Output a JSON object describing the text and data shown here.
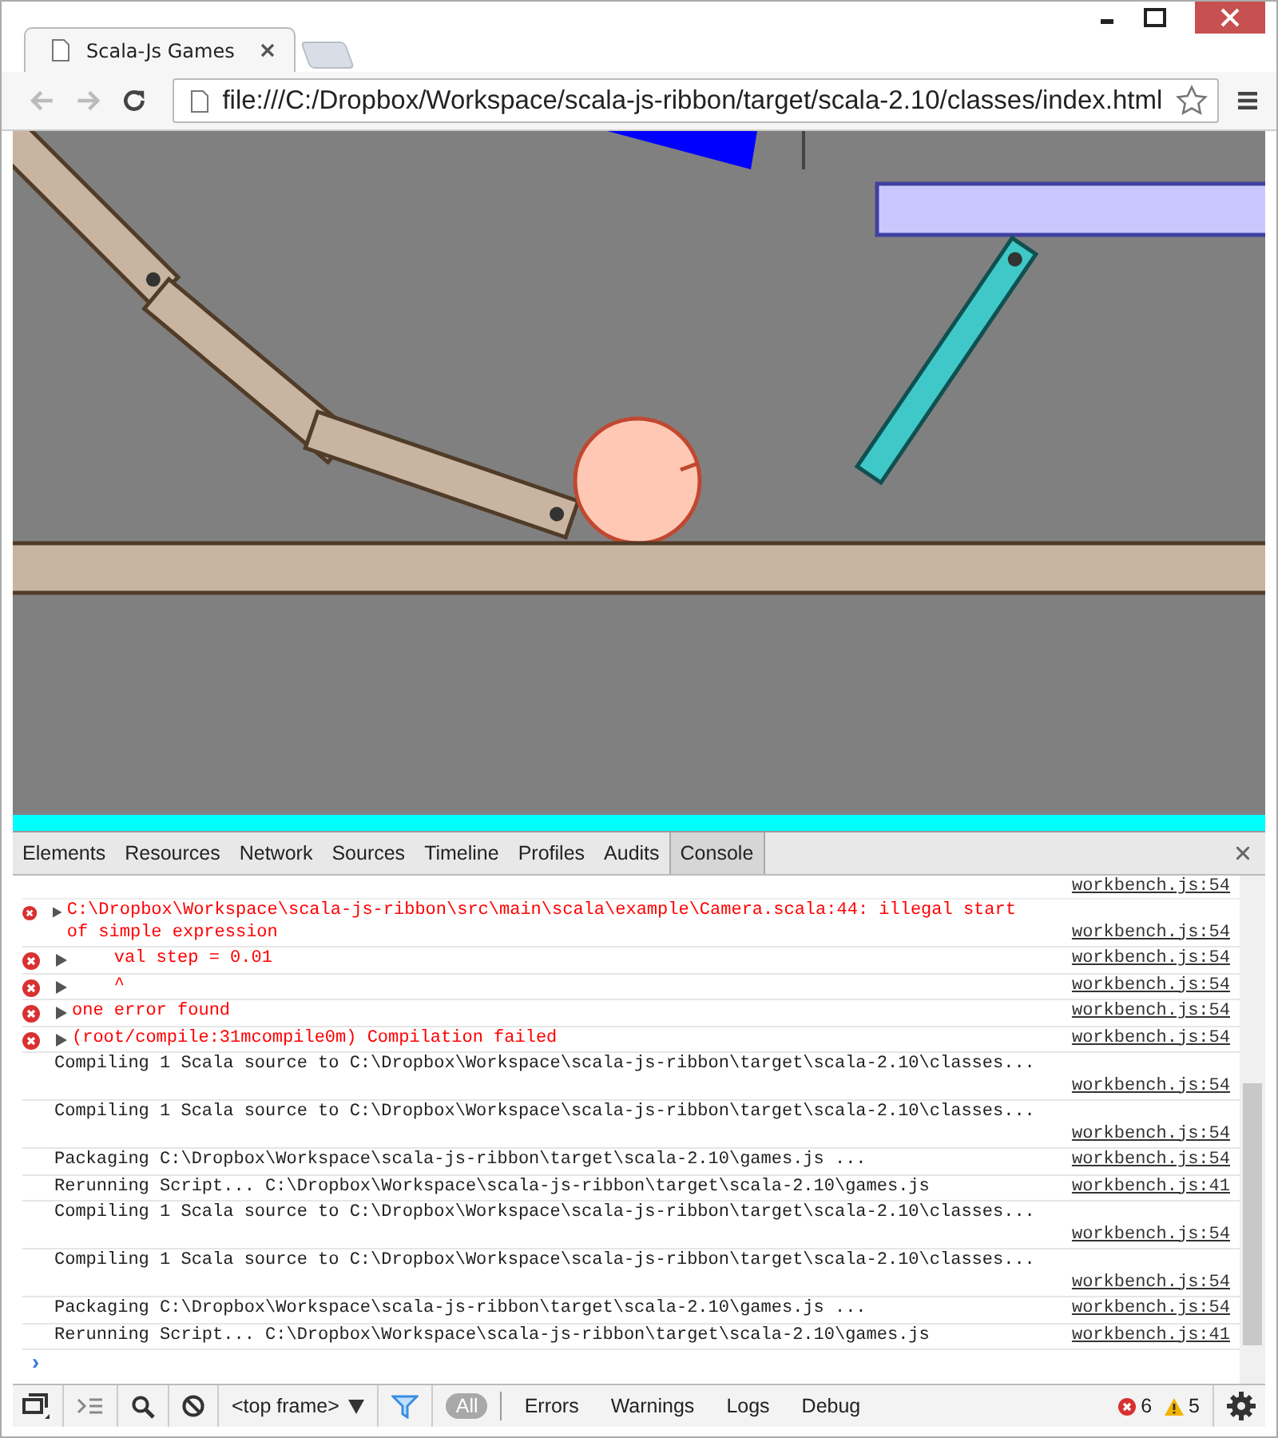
{
  "window": {
    "tabs": [
      {
        "title": "Scala-Js Games",
        "selected": true
      }
    ]
  },
  "toolbar": {
    "url": "file:///C:/Dropbox/Workspace/scala-js-ribbon/target/scala-2.10/classes/index.html"
  },
  "devtools": {
    "tabs": [
      {
        "label": "Elements",
        "selected": false
      },
      {
        "label": "Resources",
        "selected": false
      },
      {
        "label": "Network",
        "selected": false
      },
      {
        "label": "Sources",
        "selected": false
      },
      {
        "label": "Timeline",
        "selected": false
      },
      {
        "label": "Profiles",
        "selected": false
      },
      {
        "label": "Audits",
        "selected": false
      },
      {
        "label": "Console",
        "selected": true
      }
    ],
    "console": {
      "clipped_source": "workbench.js:54",
      "messages": [
        {
          "kind": "error",
          "text": "C:\\Dropbox\\Workspace\\scala-js-ribbon\\src\\main\\scala\\example\\Camera.scala:44: illegal start of simple expression",
          "source": "workbench.js:54"
        },
        {
          "kind": "error",
          "text": "    val step = 0.01",
          "source": "workbench.js:54"
        },
        {
          "kind": "error",
          "text": "    ^",
          "source": "workbench.js:54"
        },
        {
          "kind": "error",
          "text": "one error found",
          "source": "workbench.js:54"
        },
        {
          "kind": "error",
          "text": "(root/compile:31mcompile0m) Compilation failed",
          "source": "workbench.js:54"
        },
        {
          "kind": "log",
          "text": "Compiling 1 Scala source to C:\\Dropbox\\Workspace\\scala-js-ribbon\\target\\scala-2.10\\classes...",
          "source": "workbench.js:54"
        },
        {
          "kind": "log",
          "text": "Compiling 1 Scala source to C:\\Dropbox\\Workspace\\scala-js-ribbon\\target\\scala-2.10\\classes...",
          "source": "workbench.js:54"
        },
        {
          "kind": "log",
          "text": "Packaging C:\\Dropbox\\Workspace\\scala-js-ribbon\\target\\scala-2.10\\games.js ...",
          "source": "workbench.js:54"
        },
        {
          "kind": "log",
          "text": "Rerunning Script... C:\\Dropbox\\Workspace\\scala-js-ribbon\\target\\scala-2.10\\games.js",
          "source": "workbench.js:41"
        },
        {
          "kind": "log",
          "text": "Compiling 1 Scala source to C:\\Dropbox\\Workspace\\scala-js-ribbon\\target\\scala-2.10\\classes...",
          "source": "workbench.js:54"
        },
        {
          "kind": "log",
          "text": "Compiling 1 Scala source to C:\\Dropbox\\Workspace\\scala-js-ribbon\\target\\scala-2.10\\classes...",
          "source": "workbench.js:54"
        },
        {
          "kind": "log",
          "text": "Packaging C:\\Dropbox\\Workspace\\scala-js-ribbon\\target\\scala-2.10\\games.js ...",
          "source": "workbench.js:54"
        },
        {
          "kind": "log",
          "text": "Rerunning Script... C:\\Dropbox\\Workspace\\scala-js-ribbon\\target\\scala-2.10\\games.js",
          "source": "workbench.js:41"
        }
      ],
      "prompt": "›"
    },
    "bottom_bar": {
      "frame_select": "<top frame>",
      "filters": [
        {
          "label": "All",
          "selected": true
        },
        {
          "label": "Errors",
          "selected": false
        },
        {
          "label": "Warnings",
          "selected": false
        },
        {
          "label": "Logs",
          "selected": false
        },
        {
          "label": "Debug",
          "selected": false
        }
      ],
      "error_count": "6",
      "warning_count": "5"
    }
  }
}
